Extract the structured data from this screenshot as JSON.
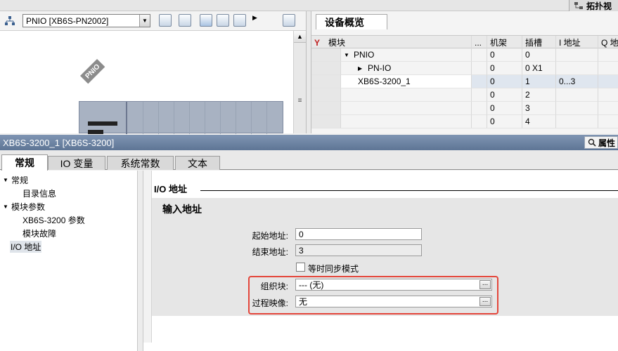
{
  "colors": {
    "title_bar": "#6a7fa0",
    "highlight": "#e4463b",
    "selected_row": "#dfe6ef"
  },
  "top": {
    "topology_tab_label": "拓扑视"
  },
  "toolbar": {
    "device_select_value": "PNIO [XB6S-PN2002]"
  },
  "canvas": {
    "rail_label": "PNIO"
  },
  "overview": {
    "tab_label": "设备概览",
    "columns": [
      "模块",
      "...",
      "机架",
      "插槽",
      "I 地址",
      "Q 地"
    ],
    "rows": [
      {
        "module": "PNIO",
        "rack": "0",
        "slot": "0",
        "iaddr": "",
        "expand": "▼"
      },
      {
        "module": "PN-IO",
        "rack": "0",
        "slot": "0 X1",
        "iaddr": "",
        "expand": "▶"
      },
      {
        "module": "XB6S-3200_1",
        "rack": "0",
        "slot": "1",
        "iaddr": "0...3",
        "expand": ""
      },
      {
        "module": "",
        "rack": "0",
        "slot": "2",
        "iaddr": "",
        "expand": ""
      },
      {
        "module": "",
        "rack": "0",
        "slot": "3",
        "iaddr": "",
        "expand": ""
      },
      {
        "module": "",
        "rack": "0",
        "slot": "4",
        "iaddr": "",
        "expand": ""
      }
    ]
  },
  "properties": {
    "title": "XB6S-3200_1 [XB6S-3200]",
    "props_button": "属性",
    "tabs": [
      "常规",
      "IO 变量",
      "系统常数",
      "文本"
    ],
    "nav": [
      {
        "label": "常规",
        "tri": "▼"
      },
      {
        "label": "目录信息",
        "tri": ""
      },
      {
        "label": "模块参数",
        "tri": "▼"
      },
      {
        "label": "XB6S-3200 参数",
        "tri": ""
      },
      {
        "label": "模块故障",
        "tri": ""
      },
      {
        "label": "I/O 地址",
        "tri": ""
      }
    ],
    "section_title": "I/O 地址",
    "group_title": "输入地址",
    "start_label": "起始地址:",
    "start_value": "0",
    "end_label": "结束地址:",
    "end_value": "3",
    "iso_label": "等时同步模式",
    "ob_label": "组织块:",
    "ob_value": "--- (无)",
    "pi_label": "过程映像:",
    "pi_value": "无",
    "browse": "..."
  }
}
